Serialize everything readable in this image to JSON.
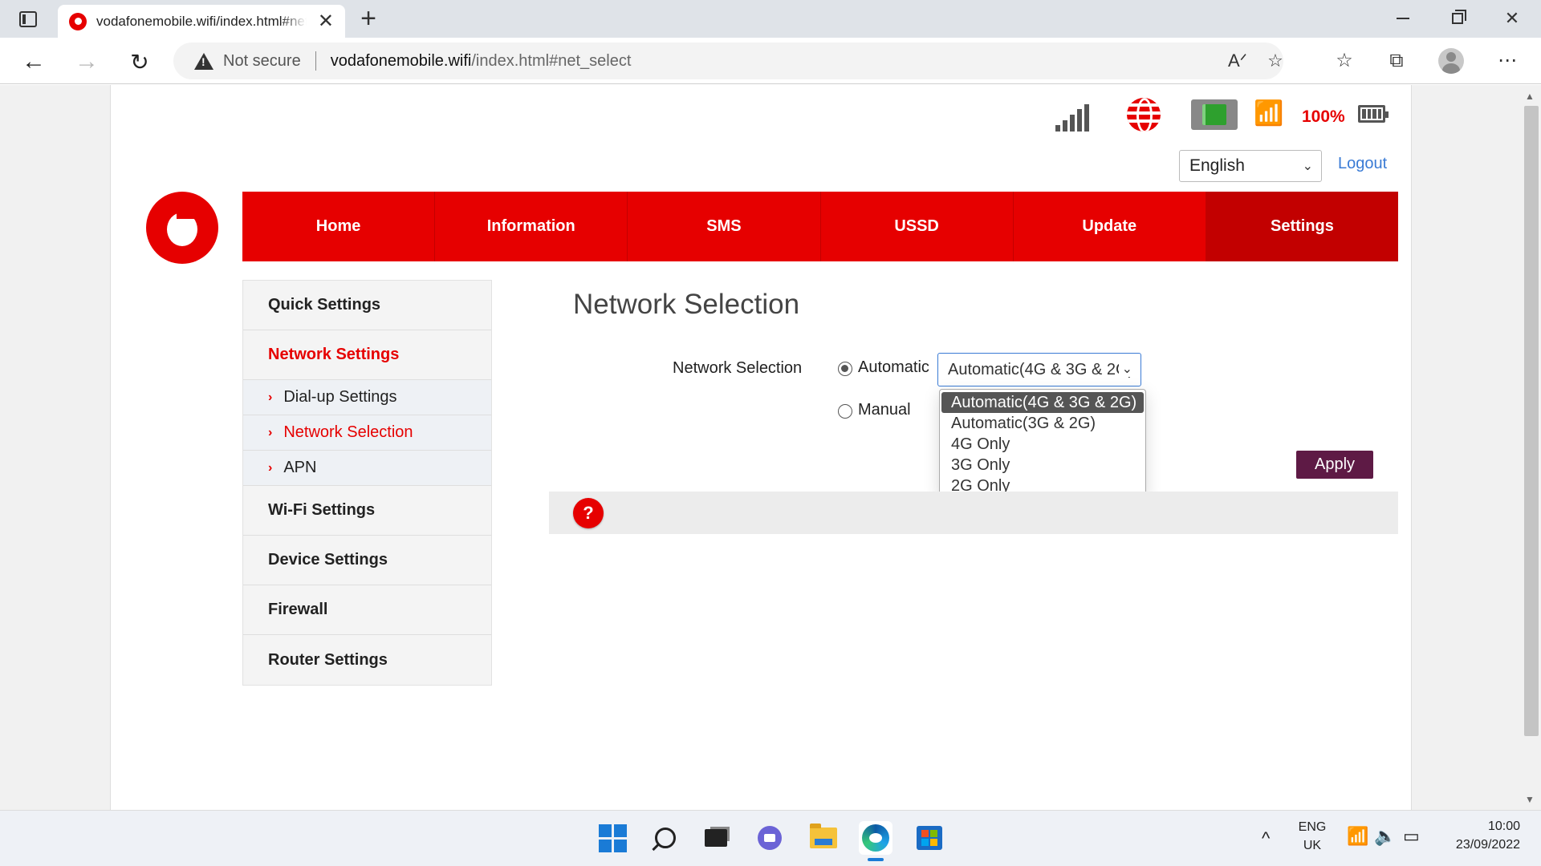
{
  "browser": {
    "tab_title": "vodafonemobile.wifi/index.html#net_select",
    "tab_close": "✕",
    "new_tab": "+",
    "not_secure": "Not secure",
    "url_host": "vodafonemobile.wifi",
    "url_path": "/index.html#net_select"
  },
  "status": {
    "battery_percent": "100%",
    "signal_bars": 5
  },
  "header": {
    "language": "English",
    "logout": "Logout"
  },
  "nav": {
    "items": [
      "Home",
      "Information",
      "SMS",
      "USSD",
      "Update",
      "Settings"
    ],
    "active": "Settings"
  },
  "sidebar": {
    "quick_settings": "Quick Settings",
    "network_settings": "Network Settings",
    "dialup_settings": "Dial-up Settings",
    "network_selection": "Network Selection",
    "apn": "APN",
    "wifi_settings": "Wi-Fi Settings",
    "device_settings": "Device Settings",
    "firewall": "Firewall",
    "router_settings": "Router Settings"
  },
  "content": {
    "title": "Network Selection",
    "field_label": "Network Selection",
    "radio_automatic": "Automatic",
    "radio_manual": "Manual",
    "selected_mode": "Automatic(4G & 3G & 2G)",
    "dropdown_options": [
      "Automatic(4G & 3G & 2G)",
      "Automatic(3G & 2G)",
      "4G Only",
      "3G Only",
      "2G Only"
    ],
    "apply": "Apply",
    "help": "?"
  },
  "taskbar": {
    "lang_top": "ENG",
    "lang_bottom": "UK",
    "time": "10:00",
    "date": "23/09/2022"
  },
  "colors": {
    "brand_red": "#e60000",
    "active_nav": "#c20000",
    "apply_button": "#5e1a45",
    "link_blue": "#3a7bd5"
  }
}
